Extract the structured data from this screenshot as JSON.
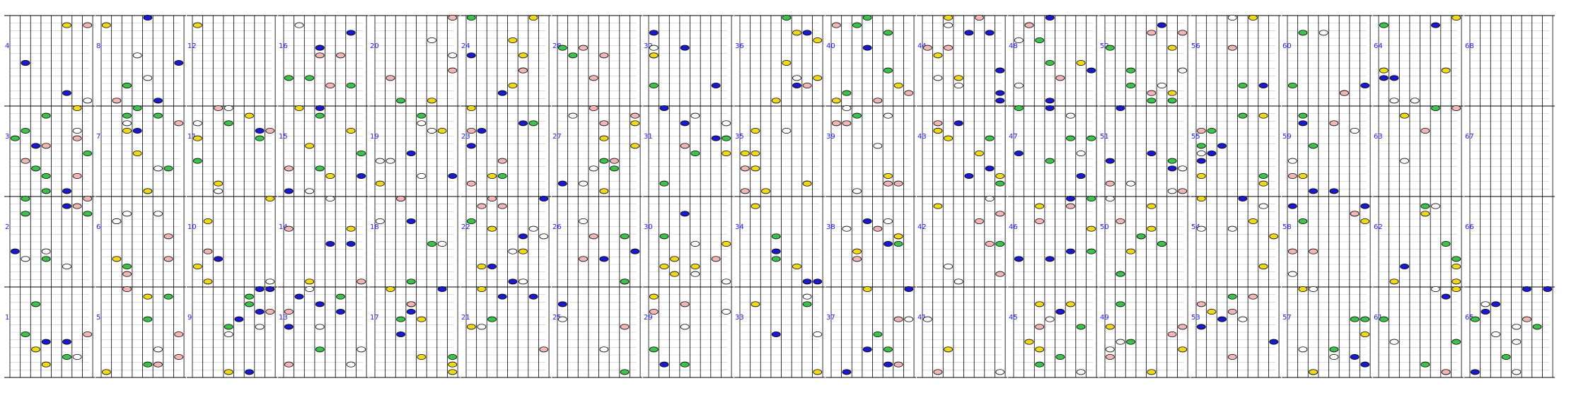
{
  "chart_data": {
    "type": "other",
    "description_free": true,
    "column_labels": [
      [
        "4",
        "3",
        "2",
        "1"
      ],
      [
        "8",
        "7",
        "6",
        "5"
      ],
      [
        "12",
        "11",
        "10",
        "9"
      ],
      [
        "16",
        "15",
        "14",
        "13"
      ],
      [
        "20",
        "19",
        "18",
        "17"
      ],
      [
        "24",
        "23",
        "22",
        "21"
      ],
      [
        "28",
        "27",
        "26",
        "25"
      ],
      [
        "32",
        "31",
        "30",
        "29"
      ],
      [
        "36",
        "35",
        "34",
        "33"
      ],
      [
        "40",
        "39",
        "38",
        "37"
      ],
      [
        "44",
        "43",
        "42",
        "41"
      ],
      [
        "48",
        "47",
        "46",
        "45"
      ],
      [
        "52",
        "51",
        "50",
        "49"
      ],
      [
        "56",
        "55",
        "54",
        "53"
      ],
      [
        "60",
        "59",
        "58",
        "57"
      ],
      [
        "64",
        "63",
        "62",
        "61"
      ],
      [
        "68",
        "67",
        "66",
        "65"
      ]
    ],
    "lanes": 8,
    "rows_per_section": 12,
    "sections_per_column": 4,
    "colors": {
      "yellow": "#f0d81a",
      "blue": "#1a1acc",
      "green": "#3cc24a",
      "pink": "#f2b6b6",
      "white": "#ffffff",
      "label": "#1a1aff",
      "line": "#000000",
      "grid": "#c8c8c8"
    }
  }
}
